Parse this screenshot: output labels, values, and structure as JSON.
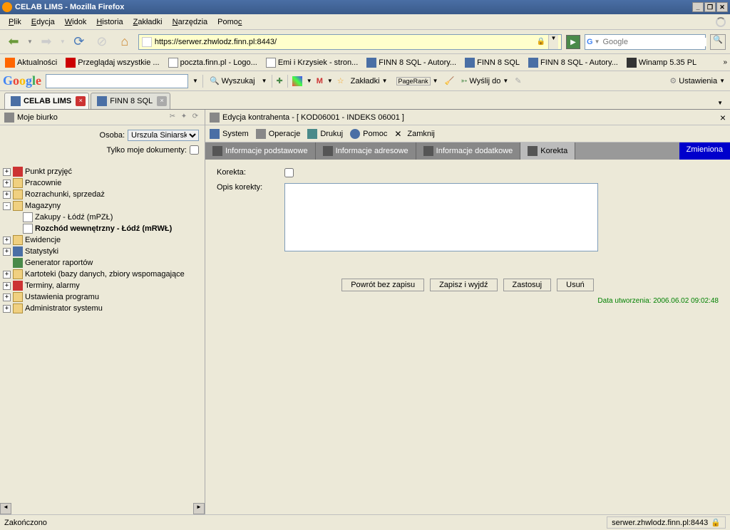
{
  "window": {
    "title": "CELAB LIMS - Mozilla Firefox"
  },
  "menubar": {
    "items": [
      "Plik",
      "Edycja",
      "Widok",
      "Historia",
      "Zakładki",
      "Narzędzia",
      "Pomoc"
    ]
  },
  "navbar": {
    "url": "https://serwer.zhwlodz.finn.pl:8443/",
    "search_placeholder": "Google"
  },
  "bookmarks": [
    "Aktualności",
    "Przeglądaj wszystkie ...",
    "poczta.finn.pl - Logo...",
    "Emi i Krzysiek - stron...",
    "FINN 8 SQL - Autory...",
    "FINN 8 SQL",
    "FINN 8 SQL - Autory...",
    "Winamp 5.35 PL"
  ],
  "googlebar": {
    "search_btn": "Wyszukaj",
    "bookmarks": "Zakładki",
    "pagerank": "PageRank",
    "send": "Wyślij do",
    "settings": "Ustawienia"
  },
  "tabs": [
    {
      "label": "CELAB LIMS",
      "active": true
    },
    {
      "label": "FINN 8 SQL",
      "active": false
    }
  ],
  "sidebar": {
    "title": "Moje biurko",
    "osoba_label": "Osoba:",
    "osoba_value": "Urszula Siniarska",
    "docs_label": "Tylko moje dokumenty:",
    "tree": [
      {
        "label": "Punkt przyjęć",
        "icon": "red",
        "exp": "+"
      },
      {
        "label": "Pracownie",
        "icon": "folder",
        "exp": "+"
      },
      {
        "label": "Rozrachunki, sprzedaż",
        "icon": "folder",
        "exp": "+"
      },
      {
        "label": "Magazyny",
        "icon": "folder",
        "exp": "-",
        "children": [
          {
            "label": "Zakupy - Łódź (mPZŁ)",
            "icon": "doc"
          },
          {
            "label": "Rozchód wewnętrzny - Łódź (mRWŁ)",
            "icon": "doc",
            "bold": true
          }
        ]
      },
      {
        "label": "Ewidencje",
        "icon": "folder",
        "exp": "+"
      },
      {
        "label": "Statystyki",
        "icon": "blue",
        "exp": "+"
      },
      {
        "label": "Generator raportów",
        "icon": "green",
        "exp": ""
      },
      {
        "label": "Kartoteki (bazy danych, zbiory wspomagające",
        "icon": "folder",
        "exp": "+"
      },
      {
        "label": "Terminy, alarmy",
        "icon": "red",
        "exp": "+"
      },
      {
        "label": "Ustawienia programu",
        "icon": "folder",
        "exp": "+"
      },
      {
        "label": "Administrator systemu",
        "icon": "folder",
        "exp": "+"
      }
    ]
  },
  "main": {
    "title": "Edycja kontrahenta - [ KOD06001 - INDEKS 06001 ]",
    "toolbar": {
      "system": "System",
      "operacje": "Operacje",
      "drukuj": "Drukuj",
      "pomoc": "Pomoc",
      "zamknij": "Zamknij"
    },
    "tabs": [
      {
        "label": "Informacje podstawowe"
      },
      {
        "label": "Informacje adresowe"
      },
      {
        "label": "Informacje dodatkowe"
      },
      {
        "label": "Korekta",
        "active": true
      }
    ],
    "status": "Zmieniona",
    "form": {
      "korekta_label": "Korekta:",
      "opis_label": "Opis korekty:"
    },
    "buttons": {
      "return": "Powrót bez zapisu",
      "save": "Zapisz i wyjdź",
      "apply": "Zastosuj",
      "delete": "Usuń"
    },
    "meta": "Data utworzenia: 2006.06.02 09:02:48"
  },
  "statusbar": {
    "status": "Zakończono",
    "server": "serwer.zhwlodz.finn.pl:8443"
  }
}
